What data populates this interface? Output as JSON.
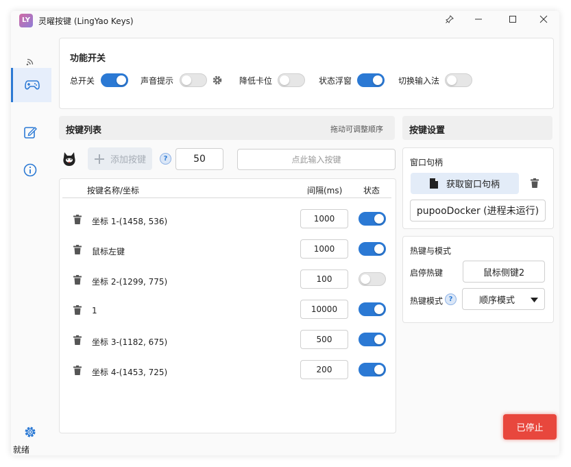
{
  "window": {
    "title": "灵曜按键 (LingYao Keys)",
    "logo_text": "LY"
  },
  "sidebar": {
    "items": [
      {
        "icon": "wireless-icon"
      },
      {
        "icon": "gamepad-icon",
        "active": true
      },
      {
        "icon": "edit-icon"
      },
      {
        "icon": "info-icon"
      }
    ],
    "bottom_icon": "gear-icon"
  },
  "status_bar": {
    "text": "就绪"
  },
  "switches": {
    "title": "功能开关",
    "items": [
      {
        "label": "总开关",
        "on": true
      },
      {
        "label": "声音提示",
        "on": false
      },
      {
        "label": "降低卡位",
        "on": false
      },
      {
        "label": "状态浮窗",
        "on": true
      },
      {
        "label": "切换输入法",
        "on": false
      }
    ]
  },
  "key_list": {
    "title": "按键列表",
    "hint": "拖动可调整顺序",
    "add_button": "添加按键",
    "default_interval": "50",
    "key_input_placeholder": "点此输入按键",
    "columns": {
      "name": "按键名称/坐标",
      "interval": "间隔(ms)",
      "status": "状态"
    },
    "rows": [
      {
        "name": "坐标 1-(1458, 536)",
        "interval": "1000",
        "on": true
      },
      {
        "name": "鼠标左键",
        "interval": "1000",
        "on": true
      },
      {
        "name": "坐标 2-(1299, 775)",
        "interval": "100",
        "on": false
      },
      {
        "name": "1",
        "interval": "10000",
        "on": true
      },
      {
        "name": "坐标 3-(1182, 675)",
        "interval": "500",
        "on": true
      },
      {
        "name": "坐标 4-(1453, 725)",
        "interval": "200",
        "on": true
      }
    ]
  },
  "settings": {
    "title": "按键设置",
    "window_handle": {
      "title": "窗口句柄",
      "get_button": "获取窗口句柄",
      "value": "pupooDocker (进程未运行)"
    },
    "hotkey": {
      "title": "热键与模式",
      "start_stop_label": "启停热键",
      "start_stop_value": "鼠标侧键2",
      "mode_label": "热键模式",
      "mode_value": "顺序模式"
    }
  },
  "run_button": {
    "label": "已停止",
    "color": "#e8473d"
  },
  "colors": {
    "accent": "#2b79d4"
  }
}
